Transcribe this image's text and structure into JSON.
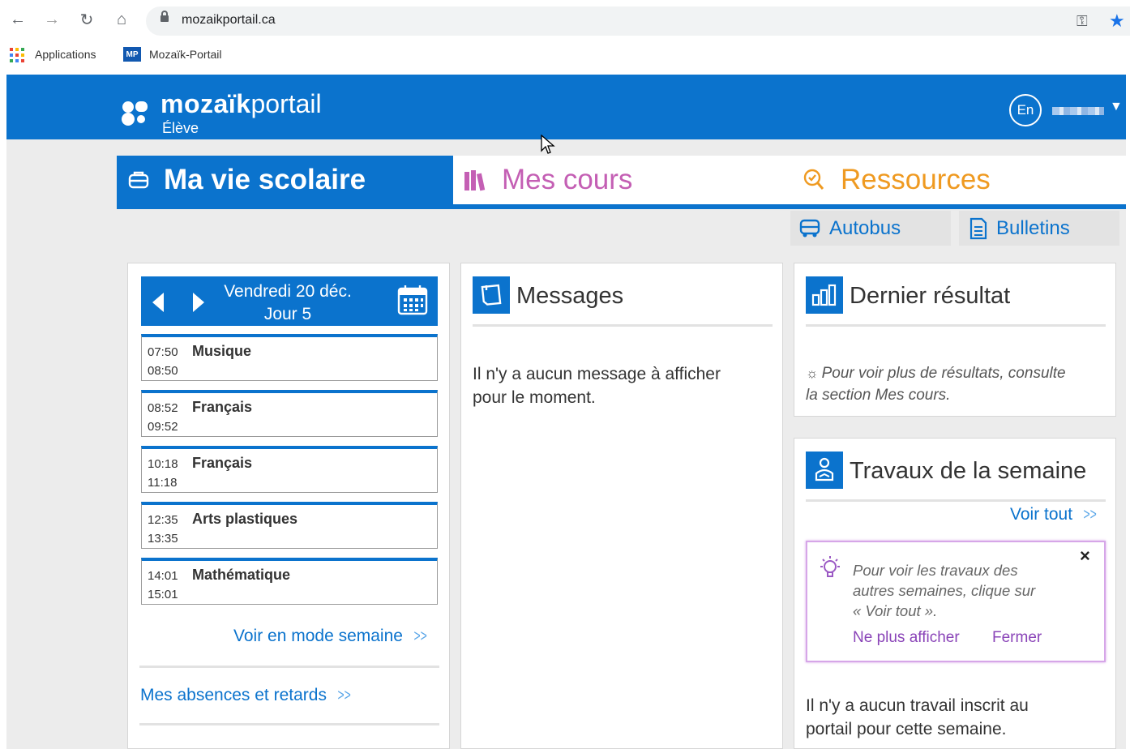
{
  "browser": {
    "url": "mozaikportail.ca",
    "bookmarks": [
      {
        "label": "Applications"
      },
      {
        "label": "Mozaïk-Portail",
        "icon_text": "MP"
      }
    ]
  },
  "header": {
    "brand_bold": "mozaïk",
    "brand_light": "portail",
    "role": "Élève",
    "lang_button": "En",
    "user_caret": "▼"
  },
  "tabs": [
    {
      "label": "Ma vie scolaire",
      "color": "#0b73cd",
      "active": true
    },
    {
      "label": "Mes cours",
      "color": "#c45fb4"
    },
    {
      "label": "Ressources",
      "color": "#ef9a21"
    }
  ],
  "subtabs": [
    {
      "label": "Autobus"
    },
    {
      "label": "Bulletins"
    }
  ],
  "schedule": {
    "date": "Vendredi 20 déc.",
    "day": "Jour 5",
    "periods": [
      {
        "start": "07:50",
        "end": "08:50",
        "subject": "Musique"
      },
      {
        "start": "08:52",
        "end": "09:52",
        "subject": "Français"
      },
      {
        "start": "10:18",
        "end": "11:18",
        "subject": "Français"
      },
      {
        "start": "12:35",
        "end": "13:35",
        "subject": "Arts plastiques"
      },
      {
        "start": "14:01",
        "end": "15:01",
        "subject": "Mathématique"
      }
    ],
    "week_link": "Voir en mode semaine",
    "absences_link": "Mes absences et retards"
  },
  "messages": {
    "title": "Messages",
    "empty_line1": "Il n'y a aucun message à afficher",
    "empty_line2": "pour le moment."
  },
  "last_result": {
    "title": "Dernier résultat",
    "hint_line1": "Pour voir plus de résultats, consulte",
    "hint_line2": "la section Mes cours."
  },
  "weekly_work": {
    "title": "Travaux de la semaine",
    "see_all": "Voir tout",
    "notice_line1": "Pour voir les travaux des",
    "notice_line2": "autres semaines, clique sur",
    "notice_line3": "« Voir tout ».",
    "notice_dismiss": "Ne plus afficher",
    "notice_close": "Fermer",
    "notice_x": "×",
    "empty_line1": "Il n'y a aucun travail inscrit au",
    "empty_line2": "portail pour cette semaine."
  },
  "colors": {
    "brand_blue": "#0b73cd",
    "courses_pink": "#c45fb4",
    "resources_orange": "#ef9a21",
    "notice_purple": "#8a44b8"
  }
}
